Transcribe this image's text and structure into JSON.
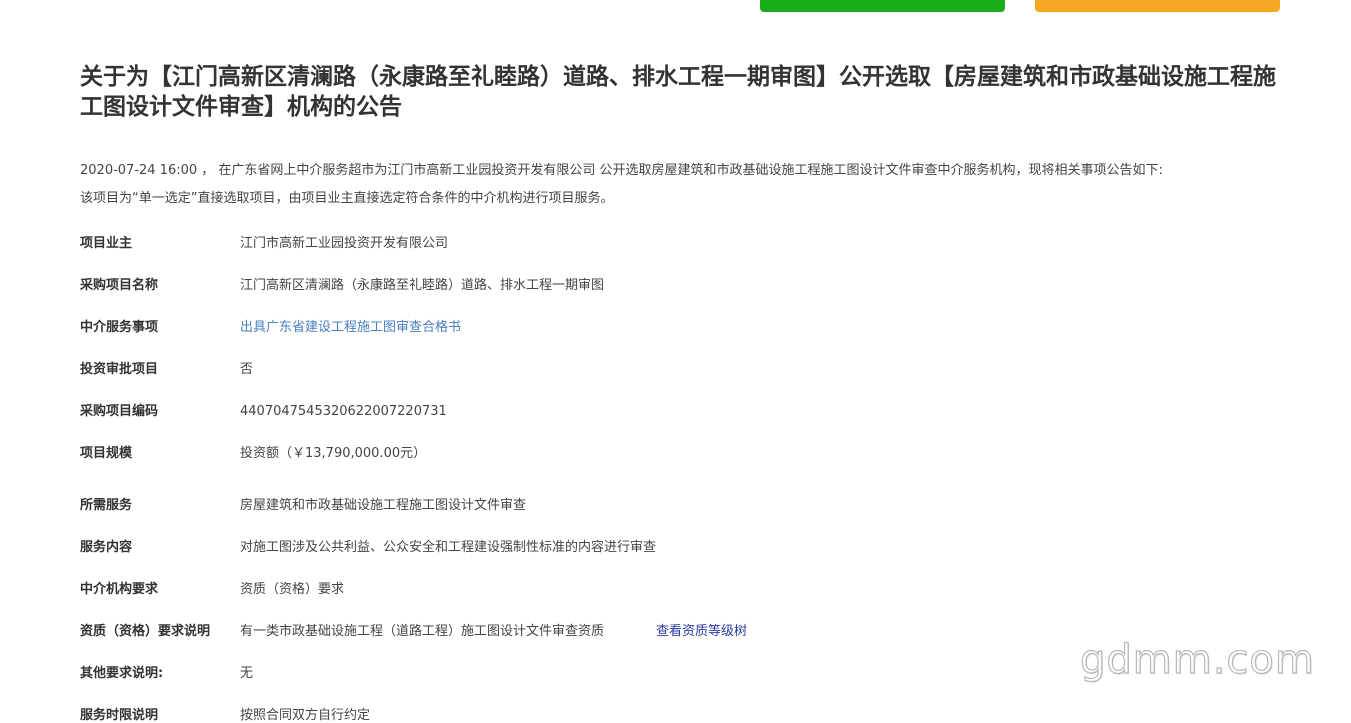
{
  "top_buttons": {
    "green_color": "#1aad19",
    "orange_color": "#f5a623"
  },
  "title": "关于为【江门高新区清澜路（永康路至礼睦路）道路、排水工程一期审图】公开选取【房屋建筑和市政基础设施工程施工图设计文件审查】机构的公告",
  "intro": {
    "line1": "2020-07-24 16:00 ， 在广东省网上中介服务超市为江门市高新工业园投资开发有限公司 公开选取房屋建筑和市政基础设施工程施工图设计文件审查中介服务机构，现将相关事项公告如下:",
    "line2": "该项目为“单一选定”直接选取项目，由项目业主直接选定符合条件的中介机构进行项目服务。"
  },
  "info": {
    "owner": {
      "label": "项目业主",
      "value": "江门市高新工业园投资开发有限公司"
    },
    "project_name": {
      "label": "采购项目名称",
      "value": "江门高新区清澜路（永康路至礼睦路）道路、排水工程一期审图"
    },
    "service_item": {
      "label": "中介服务事项",
      "value": "出具广东省建设工程施工图审查合格书"
    },
    "investment_approval": {
      "label": "投资审批项目",
      "value": "否"
    },
    "project_code": {
      "label": "采购项目编码",
      "value": "4407047545320622007220731"
    },
    "scale": {
      "label": "项目规模",
      "value": "投资额（￥13,790,000.00元）"
    },
    "required_service": {
      "label": "所需服务",
      "value": "房屋建筑和市政基础设施工程施工图设计文件审查"
    },
    "service_content": {
      "label": "服务内容",
      "value": "对施工图涉及公共利益、公众安全和工程建设强制性标准的内容进行审查"
    },
    "agency_requirement": {
      "label": "中介机构要求",
      "value": "资质（资格）要求"
    },
    "qualification_desc": {
      "label": "资质（资格）要求说明",
      "value": "有一类市政基础设施工程（道路工程）施工图设计文件审查资质",
      "link": "查看资质等级树"
    },
    "other_requirements": {
      "label": "其他要求说明:",
      "value": "无"
    },
    "service_time": {
      "label": "服务时限说明",
      "value": "按照合同双方自行约定"
    }
  },
  "watermark": "gdmm.com"
}
